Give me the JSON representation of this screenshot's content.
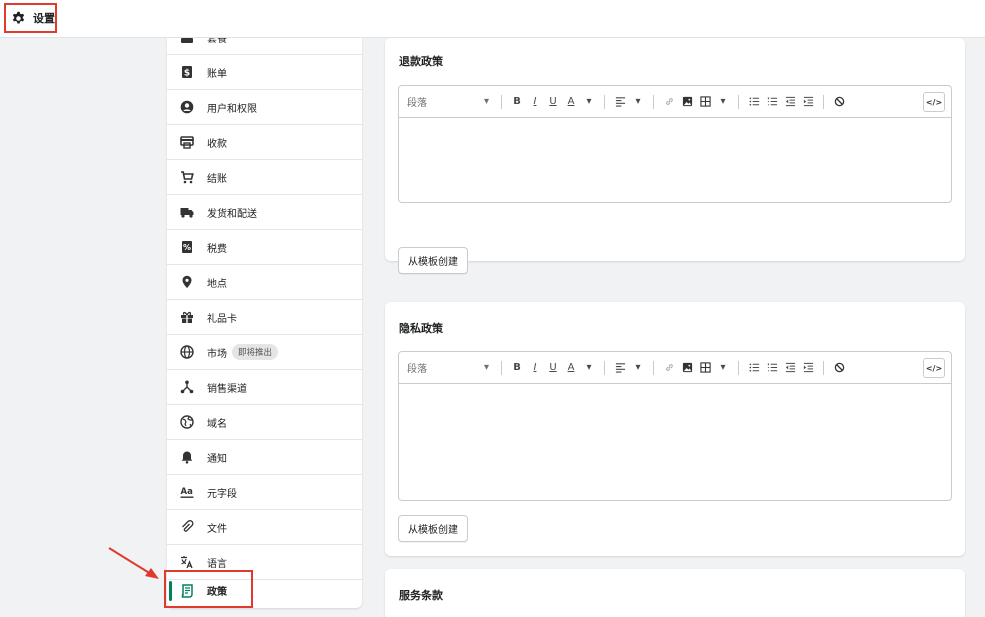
{
  "header": {
    "title": "设置"
  },
  "sidebar": {
    "items": [
      {
        "label": "套餐",
        "icon": "plan-icon"
      },
      {
        "label": "账单",
        "icon": "billing-icon"
      },
      {
        "label": "用户和权限",
        "icon": "user-icon"
      },
      {
        "label": "收款",
        "icon": "payments-icon"
      },
      {
        "label": "结账",
        "icon": "cart-icon"
      },
      {
        "label": "发货和配送",
        "icon": "truck-icon"
      },
      {
        "label": "税费",
        "icon": "tax-icon"
      },
      {
        "label": "地点",
        "icon": "location-icon"
      },
      {
        "label": "礼品卡",
        "icon": "gift-icon"
      },
      {
        "label": "市场",
        "icon": "globe-icon",
        "badge": "即将推出"
      },
      {
        "label": "销售渠道",
        "icon": "channels-icon"
      },
      {
        "label": "域名",
        "icon": "domain-icon"
      },
      {
        "label": "通知",
        "icon": "bell-icon"
      },
      {
        "label": "元字段",
        "icon": "metafields-icon"
      },
      {
        "label": "文件",
        "icon": "paperclip-icon"
      },
      {
        "label": "语言",
        "icon": "translate-icon"
      },
      {
        "label": "政策",
        "icon": "policy-icon",
        "active": true
      }
    ]
  },
  "policies": {
    "refund": {
      "title": "退款政策",
      "template_button": "从模板创建"
    },
    "privacy": {
      "title": "隐私政策",
      "template_button": "从模板创建"
    },
    "terms": {
      "title": "服务条款"
    }
  },
  "editor": {
    "format_select": "段落",
    "bold": "B",
    "italic": "I",
    "underline": "U",
    "text_color": "A",
    "code_label": "</>"
  },
  "colors": {
    "accent": "#008060",
    "highlight": "#e03a2f"
  }
}
